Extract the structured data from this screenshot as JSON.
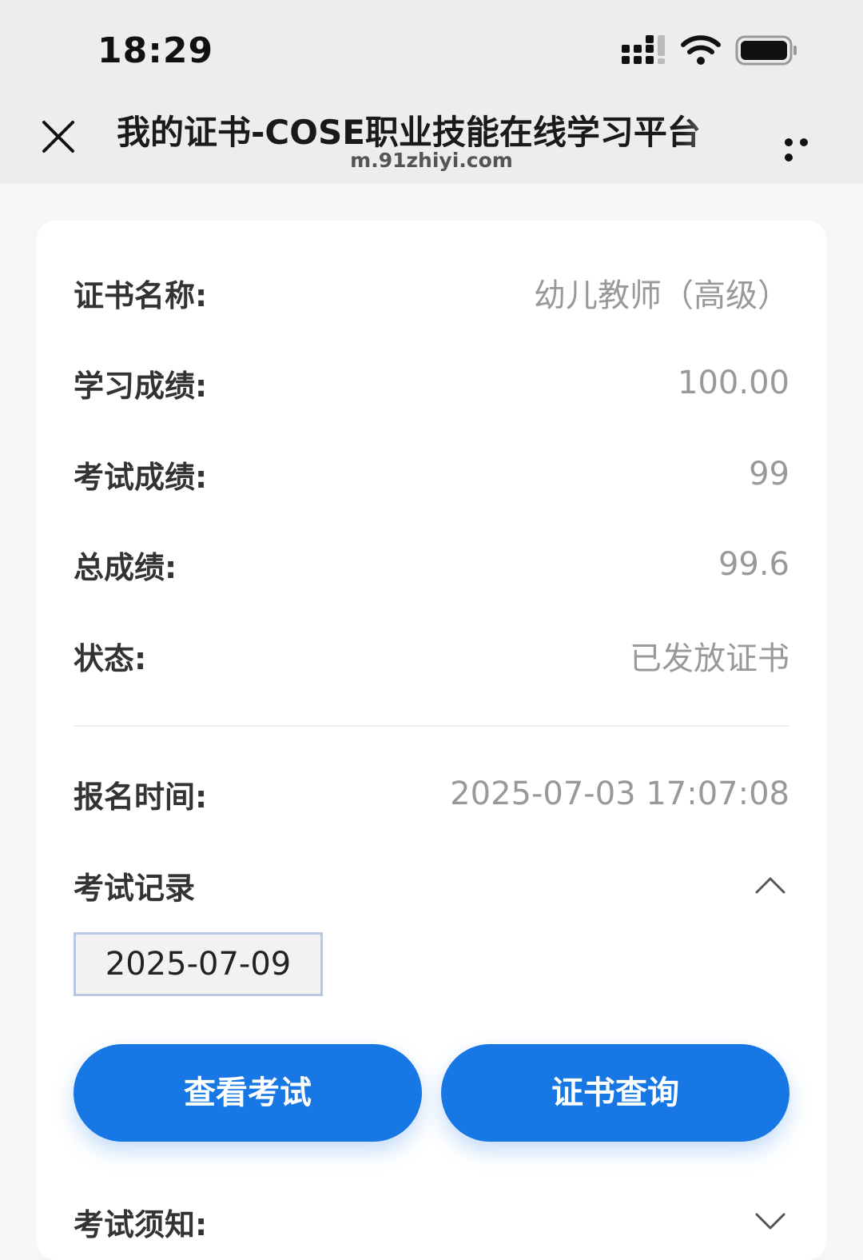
{
  "status_bar": {
    "time": "18:29",
    "icons": [
      "signal-icon",
      "wifi-icon",
      "battery-icon"
    ]
  },
  "navbar": {
    "title": "我的证书-COSE职业技能在线学习平台",
    "url": "m.91zhiyi.com",
    "close_icon": "close-icon",
    "more_icon": "more-icon"
  },
  "certificate": {
    "rows": [
      {
        "label": "证书名称:",
        "value": "幼儿教师（高级）"
      },
      {
        "label": "学习成绩:",
        "value": "100.00"
      },
      {
        "label": "考试成绩:",
        "value": "99"
      },
      {
        "label": "总成绩:",
        "value": "99.6"
      },
      {
        "label": "状态:",
        "value": "已发放证书"
      }
    ],
    "registration": {
      "label": "报名时间:",
      "value": "2025-07-03 17:07:08"
    },
    "exam_records": {
      "label": "考试记录",
      "dates": [
        "2025-07-09"
      ]
    },
    "buttons": {
      "view_exam": "查看考试",
      "cert_query": "证书查询"
    },
    "exam_notice": {
      "label": "考试须知:"
    }
  },
  "colors": {
    "primary": "#1677e5",
    "label": "#333333",
    "value": "#999999",
    "background": "#f5f6f8",
    "bar": "#ededed"
  }
}
